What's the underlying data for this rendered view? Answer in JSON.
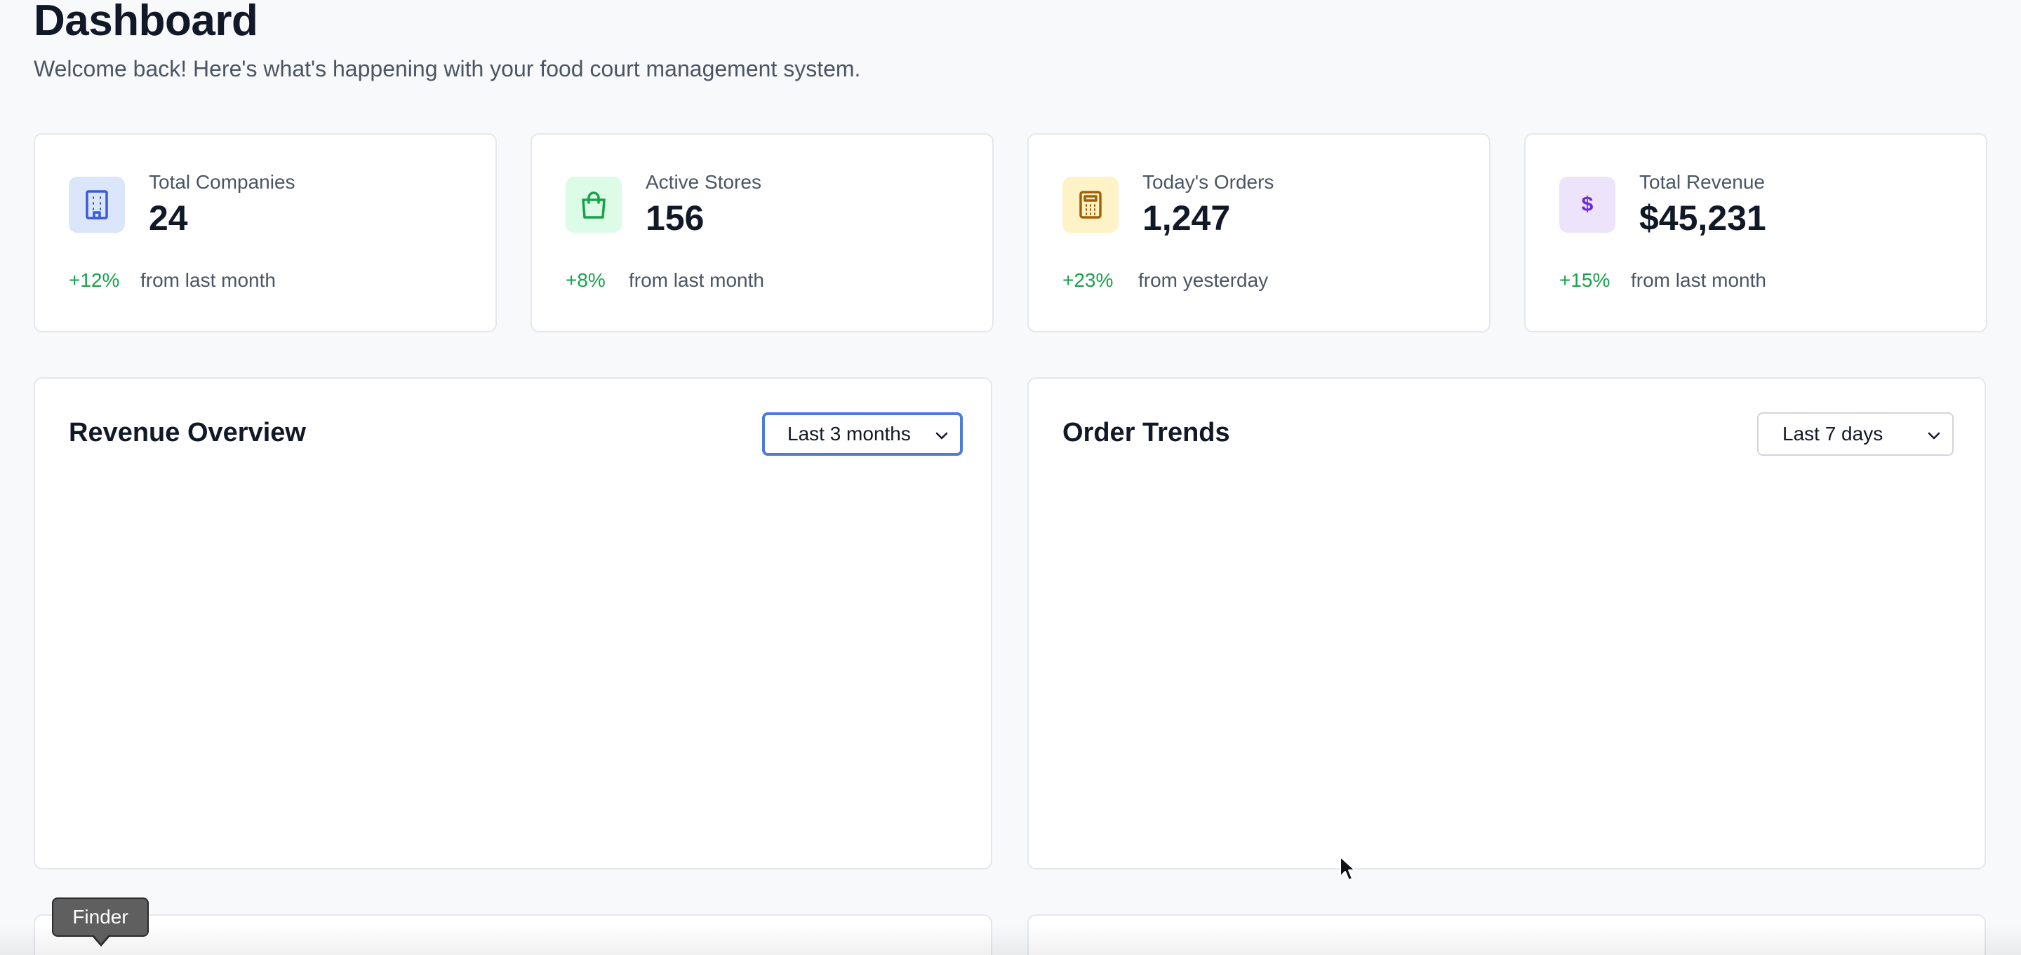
{
  "header": {
    "title": "Dashboard",
    "subtitle": "Welcome back! Here's what's happening with your food court management system."
  },
  "stats": [
    {
      "label": "Total Companies",
      "value": "24",
      "change": "+12%",
      "period": "from last month",
      "icon": "building-icon",
      "icon_bg": "#dbe6fb",
      "icon_color": "#3b5bdb"
    },
    {
      "label": "Active Stores",
      "value": "156",
      "change": "+8%",
      "period": "from last month",
      "icon": "shopping-bag-icon",
      "icon_bg": "#dcfce7",
      "icon_color": "#16a34a"
    },
    {
      "label": "Today's Orders",
      "value": "1,247",
      "change": "+23%",
      "period": "from yesterday",
      "icon": "calculator-icon",
      "icon_bg": "#fef3c7",
      "icon_color": "#a16207"
    },
    {
      "label": "Total Revenue",
      "value": "$45,231",
      "change": "+15%",
      "period": "from last month",
      "icon": "dollar-icon",
      "icon_bg": "#ede4fb",
      "icon_color": "#6d28d9"
    }
  ],
  "charts": {
    "revenue": {
      "title": "Revenue Overview",
      "range": "Last 3 months"
    },
    "orders": {
      "title": "Order Trends",
      "range": "Last 7 days"
    }
  },
  "dock": {
    "tooltip": "Finder"
  },
  "colors": {
    "positive": "#16a34a",
    "focus": "#4f7bd9"
  }
}
